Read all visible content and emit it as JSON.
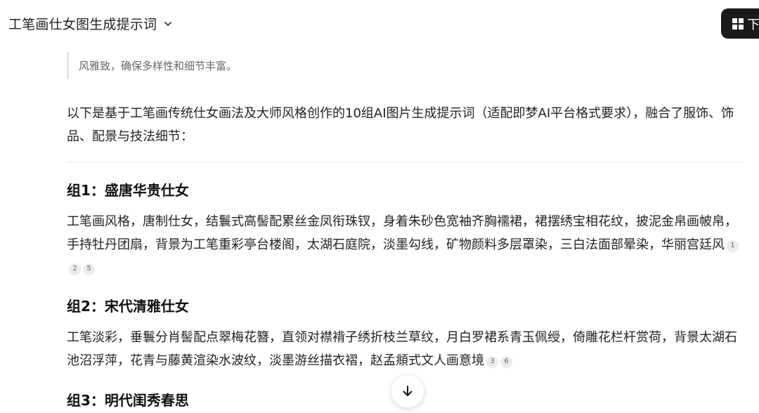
{
  "header": {
    "title": "工笔画仕女图生成提示词",
    "download_label": "下"
  },
  "quote_text": "风雅致，确保多样性和细节丰富。",
  "intro": "以下是基于工笔画传统仕女画法及大师风格创作的10组AI图片生成提示词（适配即梦AI平台格式要求），融合了服饰、饰品、配景与技法细节：",
  "groups": [
    {
      "title": "组1：盛唐华贵仕女",
      "body": "工笔画风格，唐制仕女，结鬟式高髻配累丝金凤衔珠钗，身着朱砂色宽袖齐胸襦裙，裙摆绣宝相花纹，披泥金帛画帔帛，手持牡丹团扇，背景为工笔重彩亭台楼阁，太湖石庭院，淡墨勾线，矿物颜料多层罩染，三白法面部晕染，华丽宫廷风",
      "citations": [
        "1",
        "2",
        "5"
      ]
    },
    {
      "title": "组2：宋代清雅仕女",
      "body": "工笔淡彩，垂鬟分肖髻配点翠梅花簪，直领对襟褙子绣折枝兰草纹，月白罗裙系青玉佩绶，倚雕花栏杆赏荷，背景太湖石池沼浮萍，花青与藤黄渲染水波纹，淡墨游丝描衣褶，赵孟頫式文人画意境",
      "citations": [
        "3",
        "6"
      ]
    },
    {
      "title": "组3：明代闺秀春思"
    }
  ]
}
